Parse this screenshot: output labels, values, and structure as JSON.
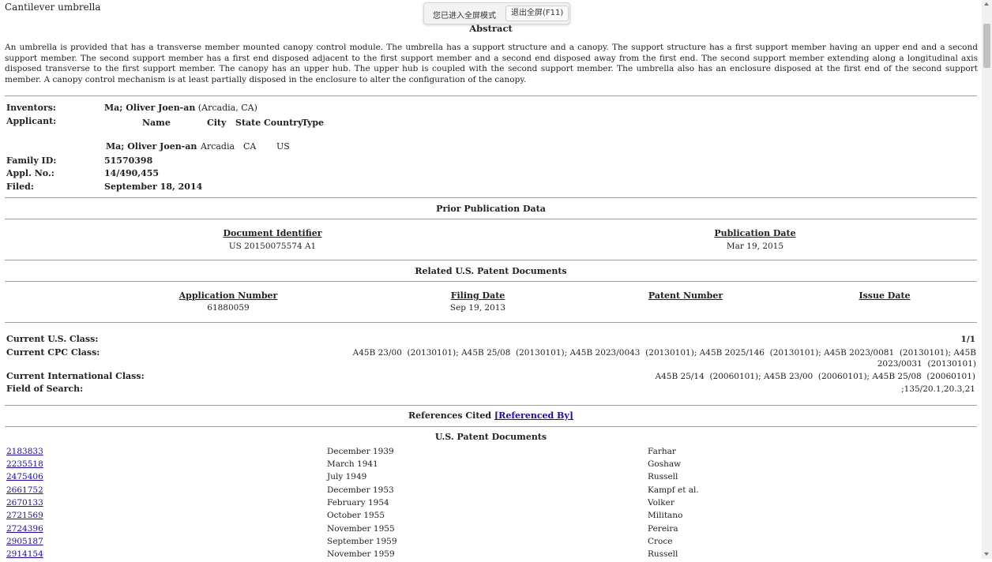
{
  "title": "Cantilever umbrella",
  "fullscreen": {
    "message": "您已进入全屏模式",
    "exit_label": "退出全屏(F11)"
  },
  "abstract": {
    "heading": "Abstract",
    "text": "An umbrella is provided that has a transverse member mounted canopy control module. The umbrella has a support structure and a canopy. The support structure has a first support member having an upper end and a second support member. The second support member has a first end disposed adjacent to the first support member and a second end disposed away from the first end. The second support member extending along a longitudinal axis disposed transverse to the first support member. The canopy has an upper hub. The upper hub is coupled with the second support member. The umbrella also has an enclosure disposed at the first end of the second support member. A canopy control mechanism is at least partially disposed in the enclosure to alter the configuration of the canopy."
  },
  "inventors": {
    "label": "Inventors:",
    "name": "Ma; Oliver Joen-an",
    "location": "(Arcadia, CA)"
  },
  "applicant": {
    "label": "Applicant:",
    "headers": [
      "Name",
      "City",
      "State",
      "Country",
      "Type"
    ],
    "name": "Ma; Oliver Joen-an",
    "city": "Arcadia",
    "state": "CA",
    "country": "US"
  },
  "family_id": {
    "label": "Family ID:",
    "value": "51570398"
  },
  "appl_no": {
    "label": "Appl. No.:",
    "value": "14/490,455"
  },
  "filed": {
    "label": "Filed:",
    "value": "September 18, 2014"
  },
  "prior_publication": {
    "heading": "Prior Publication Data",
    "doc_id_header": "Document Identifier",
    "pub_date_header": "Publication Date",
    "doc_id": "US 20150075574 A1",
    "pub_date": "Mar 19, 2015"
  },
  "related_docs": {
    "heading": "Related U.S. Patent Documents",
    "headers": [
      "Application Number",
      "Filing Date",
      "Patent Number",
      "Issue Date"
    ],
    "app_number": "61880059",
    "filing_date": "Sep 19, 2013"
  },
  "classes": {
    "us_label": "Current U.S. Class:",
    "us_value": "1/1",
    "cpc_label": "Current CPC Class:",
    "cpc_line1": "A45B 23/00  (20130101); A45B 25/08  (20130101); A45B 2023/0043  (20130101); A45B 2025/146  (20130101); A45B 2023/0081  (20130101); A45B",
    "cpc_line2": "2023/0031  (20130101)",
    "intl_label": "Current International Class:",
    "intl_value": "A45B 25/14  (20060101); A45B 23/00  (20060101); A45B 25/08  (20060101)",
    "search_label": "Field of Search:",
    "search_value": ";135/20.1,20.3,21"
  },
  "references": {
    "heading": "References Cited",
    "referenced_by": "[Referenced By]",
    "us_heading": "U.S. Patent Documents",
    "rows": [
      {
        "number": "2183833",
        "date": "December 1939",
        "name": "Farhar"
      },
      {
        "number": "2235518",
        "date": "March 1941",
        "name": "Goshaw"
      },
      {
        "number": "2475406",
        "date": "July 1949",
        "name": "Russell"
      },
      {
        "number": "2661752",
        "date": "December 1953",
        "name": "Kampf et al."
      },
      {
        "number": "2670133",
        "date": "February 1954",
        "name": "Volker"
      },
      {
        "number": "2721569",
        "date": "October 1955",
        "name": "Militano"
      },
      {
        "number": "2724396",
        "date": "November 1955",
        "name": "Pereira"
      },
      {
        "number": "2905187",
        "date": "September 1959",
        "name": "Croce"
      },
      {
        "number": "2914154",
        "date": "November 1959",
        "name": "Russell"
      }
    ]
  }
}
